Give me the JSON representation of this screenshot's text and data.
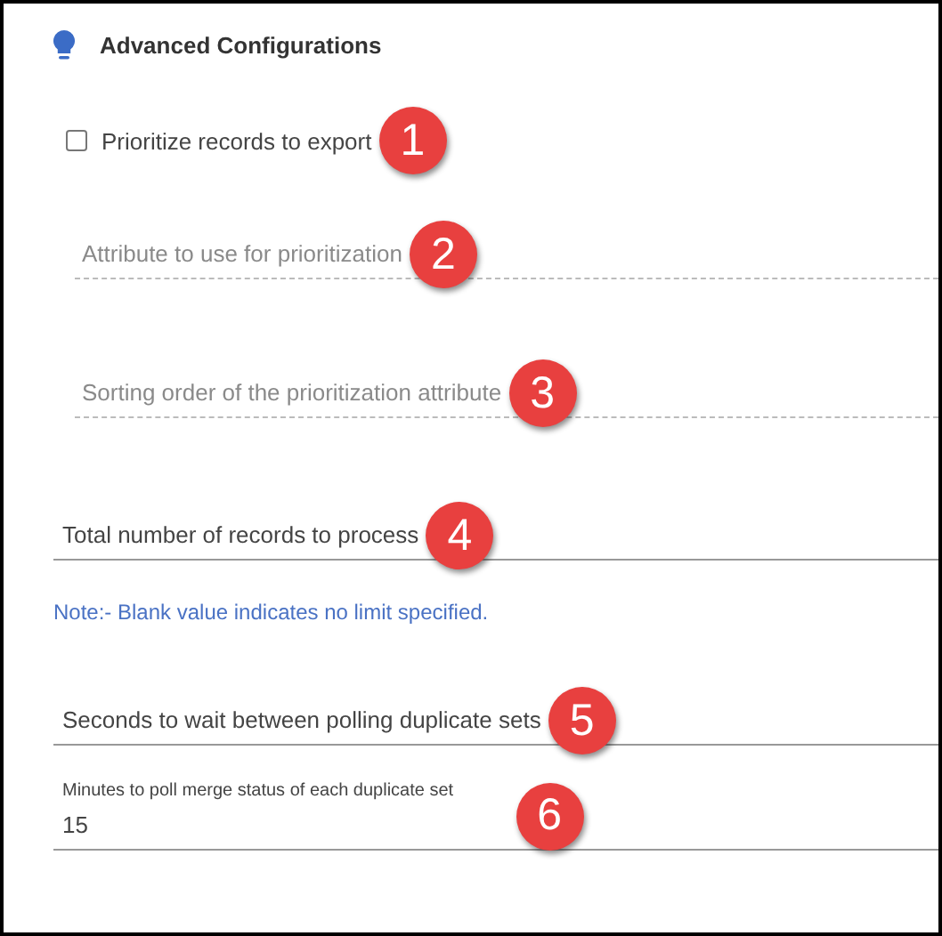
{
  "section": {
    "title": "Advanced Configurations"
  },
  "fields": [
    {
      "kind": "checkbox",
      "label": "Prioritize records to export",
      "checked": false,
      "marker": "1"
    },
    {
      "kind": "field",
      "placeholder": "Attribute to use for prioritization",
      "disabled": true,
      "marker": "2"
    },
    {
      "kind": "field",
      "placeholder": "Sorting order of the prioritization attribute",
      "disabled": true,
      "marker": "3"
    },
    {
      "kind": "field",
      "placeholder": "Total number of records to process",
      "disabled": false,
      "marker": "4"
    },
    {
      "kind": "note",
      "text": "Note:- Blank value indicates no limit specified."
    },
    {
      "kind": "field",
      "placeholder": "Seconds to wait between polling duplicate sets",
      "disabled": false,
      "marker": "5"
    },
    {
      "kind": "field",
      "label": "Minutes to poll merge status of each duplicate set",
      "value": "15",
      "disabled": false,
      "marker": "6"
    }
  ]
}
